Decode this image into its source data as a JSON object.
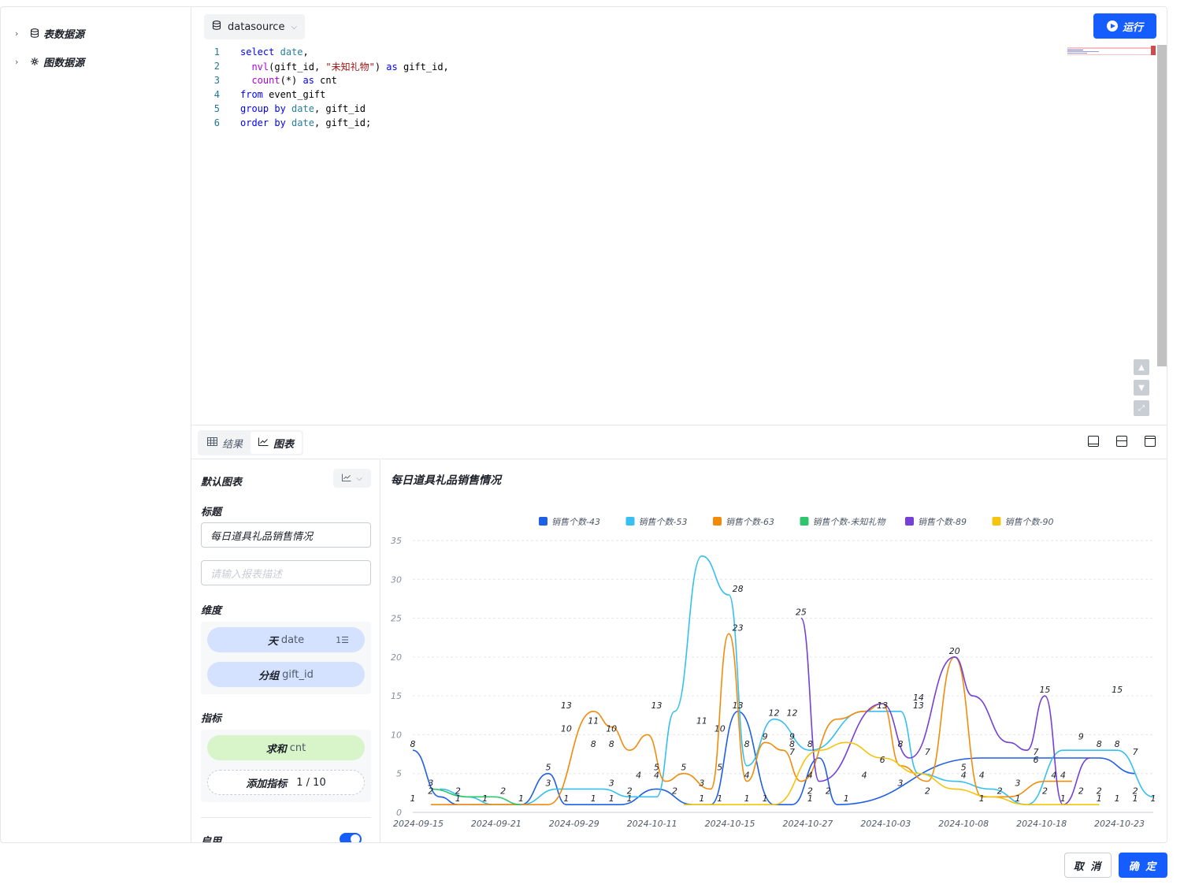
{
  "sidebar": {
    "items": [
      {
        "label": "表数据源",
        "icon": "database-icon"
      },
      {
        "label": "图数据源",
        "icon": "graph-icon"
      }
    ]
  },
  "toolbar": {
    "datasource_label": "datasource",
    "run_label": "运行"
  },
  "editor": {
    "lines": [
      {
        "n": "1",
        "text": "select date,"
      },
      {
        "n": "2",
        "text": "  nvl(gift_id, \"未知礼物\") as gift_id,"
      },
      {
        "n": "3",
        "text": "  count(*) as cnt"
      },
      {
        "n": "4",
        "text": "from event_gift"
      },
      {
        "n": "5",
        "text": "group by date, gift_id"
      },
      {
        "n": "6",
        "text": "order by date, gift_id;"
      }
    ]
  },
  "tabs": [
    {
      "label": "结果",
      "icon": "table-icon"
    },
    {
      "label": "图表",
      "icon": "line-chart-icon"
    }
  ],
  "config": {
    "default_chart_label": "默认图表",
    "title_label": "标题",
    "title_value": "每日道具礼品销售情况",
    "desc_placeholder": "请输入报表描述",
    "dimension_label": "维度",
    "dimensions": [
      {
        "prefix": "天",
        "field": "date"
      },
      {
        "prefix": "分组",
        "field": "gift_id"
      }
    ],
    "metric_label": "指标",
    "metric": {
      "prefix": "求和",
      "field": "cnt"
    },
    "add_metric": {
      "label": "添加指标",
      "count": "1 / 10"
    },
    "enable_label": "启用"
  },
  "chart_data": {
    "type": "line",
    "title": "每日道具礼品销售情况",
    "ylim": [
      0,
      35
    ],
    "yticks": [
      "0",
      "5",
      "10",
      "15",
      "20",
      "25",
      "30",
      "35"
    ],
    "xticks": [
      "2024-09-15",
      "2024-09-21",
      "2024-09-29",
      "2024-10-11",
      "2024-10-15",
      "2024-10-27",
      "2024-10-03",
      "2024-10-08",
      "2024-10-18",
      "2024-10-23"
    ],
    "legend_position": "top",
    "grid": true,
    "series": [
      {
        "name": "销售个数-43",
        "color": "#1f5fe6",
        "points": [
          [
            0,
            8
          ],
          [
            3,
            2
          ],
          [
            5,
            1
          ],
          [
            9,
            1
          ],
          [
            12,
            1
          ],
          [
            15,
            5
          ],
          [
            17,
            1
          ],
          [
            19,
            1
          ],
          [
            21,
            1
          ],
          [
            23,
            1
          ],
          [
            27,
            3
          ],
          [
            31,
            1
          ],
          [
            33,
            1
          ],
          [
            36,
            13
          ],
          [
            40,
            1
          ],
          [
            42,
            1
          ],
          [
            45,
            7
          ],
          [
            47,
            1
          ],
          [
            63,
            7
          ],
          [
            68,
            7
          ],
          [
            72,
            7
          ],
          [
            76,
            7
          ],
          [
            80,
            5
          ]
        ]
      },
      {
        "name": "销售个数-53",
        "color": "#36bff0",
        "points": [
          [
            3,
            3
          ],
          [
            6,
            2
          ],
          [
            9,
            1
          ],
          [
            12,
            1
          ],
          [
            16,
            3
          ],
          [
            18,
            3
          ],
          [
            21,
            3
          ],
          [
            24,
            2
          ],
          [
            27,
            2
          ],
          [
            29,
            13
          ],
          [
            32,
            33
          ],
          [
            35,
            28
          ],
          [
            37,
            6
          ],
          [
            40,
            12
          ],
          [
            44,
            8
          ],
          [
            50,
            13
          ],
          [
            54,
            13
          ],
          [
            56,
            5
          ],
          [
            60,
            4
          ],
          [
            64,
            3
          ],
          [
            68,
            1
          ],
          [
            72,
            8
          ],
          [
            78,
            8
          ],
          [
            82,
            2
          ]
        ]
      },
      {
        "name": "销售个数-63",
        "color": "#f28b0c",
        "points": [
          [
            2,
            1
          ],
          [
            15,
            1
          ],
          [
            20,
            13
          ],
          [
            22,
            11
          ],
          [
            24,
            8
          ],
          [
            26,
            10
          ],
          [
            28,
            4
          ],
          [
            30,
            5
          ],
          [
            33,
            3
          ],
          [
            35,
            23
          ],
          [
            37,
            4
          ],
          [
            39,
            9
          ],
          [
            41,
            8
          ],
          [
            43,
            4
          ],
          [
            47,
            12
          ],
          [
            50,
            13
          ],
          [
            52,
            14
          ],
          [
            54,
            6
          ],
          [
            57,
            4
          ],
          [
            60,
            20
          ],
          [
            63,
            2
          ],
          [
            66,
            2
          ],
          [
            70,
            4
          ],
          [
            73,
            4
          ]
        ]
      },
      {
        "name": "销售个数-未知礼物",
        "color": "#2fc56c",
        "points": [
          [
            2,
            3
          ],
          [
            6,
            2
          ],
          [
            9,
            2
          ],
          [
            12,
            1
          ]
        ]
      },
      {
        "name": "销售个数-89",
        "color": "#7440d6",
        "points": [
          [
            43,
            25
          ],
          [
            45,
            4
          ],
          [
            52,
            14
          ],
          [
            55,
            7
          ],
          [
            60,
            20
          ],
          [
            62,
            15
          ],
          [
            66,
            9
          ],
          [
            68,
            8
          ],
          [
            70,
            15
          ],
          [
            72,
            1
          ],
          [
            75,
            7
          ]
        ]
      },
      {
        "name": "销售个数-90",
        "color": "#f5c40f",
        "points": [
          [
            30,
            1
          ],
          [
            40,
            1
          ],
          [
            45,
            8
          ],
          [
            48,
            9
          ],
          [
            52,
            7
          ],
          [
            56,
            5
          ],
          [
            60,
            3
          ],
          [
            64,
            2
          ],
          [
            68,
            1
          ],
          [
            72,
            1
          ],
          [
            76,
            1
          ]
        ]
      }
    ],
    "data_labels": [
      {
        "v": "8",
        "x": 0,
        "y": 8
      },
      {
        "v": "1",
        "x": 0,
        "y": 1
      },
      {
        "v": "3",
        "x": 2,
        "y": 3
      },
      {
        "v": "2",
        "x": 2,
        "y": 2
      },
      {
        "v": "2",
        "x": 5,
        "y": 2
      },
      {
        "v": "1",
        "x": 5,
        "y": 1
      },
      {
        "v": "1",
        "x": 8,
        "y": 1
      },
      {
        "v": "2",
        "x": 10,
        "y": 2
      },
      {
        "v": "1",
        "x": 12,
        "y": 1
      },
      {
        "v": "5",
        "x": 15,
        "y": 5
      },
      {
        "v": "3",
        "x": 15,
        "y": 3
      },
      {
        "v": "1",
        "x": 17,
        "y": 1
      },
      {
        "v": "13",
        "x": 17,
        "y": 13
      },
      {
        "v": "10",
        "x": 17,
        "y": 10
      },
      {
        "v": "11",
        "x": 20,
        "y": 11
      },
      {
        "v": "8",
        "x": 20,
        "y": 8
      },
      {
        "v": "1",
        "x": 20,
        "y": 1
      },
      {
        "v": "10",
        "x": 22,
        "y": 10
      },
      {
        "v": "8",
        "x": 22,
        "y": 8
      },
      {
        "v": "3",
        "x": 22,
        "y": 3
      },
      {
        "v": "1",
        "x": 22,
        "y": 1
      },
      {
        "v": "2",
        "x": 24,
        "y": 2
      },
      {
        "v": "1",
        "x": 24,
        "y": 1
      },
      {
        "v": "4",
        "x": 25,
        "y": 4
      },
      {
        "v": "5",
        "x": 27,
        "y": 5
      },
      {
        "v": "4",
        "x": 27,
        "y": 4
      },
      {
        "v": "13",
        "x": 27,
        "y": 13
      },
      {
        "v": "2",
        "x": 29,
        "y": 2
      },
      {
        "v": "5",
        "x": 30,
        "y": 5
      },
      {
        "v": "11",
        "x": 32,
        "y": 11
      },
      {
        "v": "3",
        "x": 32,
        "y": 3
      },
      {
        "v": "1",
        "x": 32,
        "y": 1
      },
      {
        "v": "10",
        "x": 34,
        "y": 10
      },
      {
        "v": "5",
        "x": 34,
        "y": 5
      },
      {
        "v": "1",
        "x": 34,
        "y": 1
      },
      {
        "v": "28",
        "x": 36,
        "y": 28
      },
      {
        "v": "23",
        "x": 36,
        "y": 23
      },
      {
        "v": "13",
        "x": 36,
        "y": 13
      },
      {
        "v": "8",
        "x": 37,
        "y": 8
      },
      {
        "v": "4",
        "x": 37,
        "y": 4
      },
      {
        "v": "1",
        "x": 37,
        "y": 1
      },
      {
        "v": "9",
        "x": 39,
        "y": 9
      },
      {
        "v": "1",
        "x": 39,
        "y": 1
      },
      {
        "v": "12",
        "x": 40,
        "y": 12
      },
      {
        "v": "12",
        "x": 42,
        "y": 12
      },
      {
        "v": "25",
        "x": 43,
        "y": 25
      },
      {
        "v": "9",
        "x": 42,
        "y": 9
      },
      {
        "v": "8",
        "x": 42,
        "y": 8
      },
      {
        "v": "7",
        "x": 42,
        "y": 7
      },
      {
        "v": "8",
        "x": 44,
        "y": 8
      },
      {
        "v": "4",
        "x": 44,
        "y": 4
      },
      {
        "v": "2",
        "x": 44,
        "y": 2
      },
      {
        "v": "1",
        "x": 44,
        "y": 1
      },
      {
        "v": "2",
        "x": 46,
        "y": 2
      },
      {
        "v": "1",
        "x": 48,
        "y": 1
      },
      {
        "v": "4",
        "x": 50,
        "y": 4
      },
      {
        "v": "6",
        "x": 52,
        "y": 6
      },
      {
        "v": "13",
        "x": 52,
        "y": 13
      },
      {
        "v": "8",
        "x": 54,
        "y": 8
      },
      {
        "v": "3",
        "x": 54,
        "y": 3
      },
      {
        "v": "14",
        "x": 56,
        "y": 14
      },
      {
        "v": "13",
        "x": 56,
        "y": 13
      },
      {
        "v": "7",
        "x": 57,
        "y": 7
      },
      {
        "v": "2",
        "x": 57,
        "y": 2
      },
      {
        "v": "20",
        "x": 60,
        "y": 20
      },
      {
        "v": "5",
        "x": 61,
        "y": 5
      },
      {
        "v": "4",
        "x": 61,
        "y": 4
      },
      {
        "v": "4",
        "x": 63,
        "y": 4
      },
      {
        "v": "1",
        "x": 63,
        "y": 1
      },
      {
        "v": "2",
        "x": 65,
        "y": 2
      },
      {
        "v": "1",
        "x": 67,
        "y": 1
      },
      {
        "v": "3",
        "x": 67,
        "y": 3
      },
      {
        "v": "7",
        "x": 69,
        "y": 7
      },
      {
        "v": "6",
        "x": 69,
        "y": 6
      },
      {
        "v": "2",
        "x": 70,
        "y": 2
      },
      {
        "v": "15",
        "x": 70,
        "y": 15
      },
      {
        "v": "4",
        "x": 71,
        "y": 4
      },
      {
        "v": "4",
        "x": 72,
        "y": 4
      },
      {
        "v": "1",
        "x": 72,
        "y": 1
      },
      {
        "v": "9",
        "x": 74,
        "y": 9
      },
      {
        "v": "2",
        "x": 74,
        "y": 2
      },
      {
        "v": "8",
        "x": 76,
        "y": 8
      },
      {
        "v": "2",
        "x": 76,
        "y": 2
      },
      {
        "v": "1",
        "x": 76,
        "y": 1
      },
      {
        "v": "8",
        "x": 78,
        "y": 8
      },
      {
        "v": "15",
        "x": 78,
        "y": 15
      },
      {
        "v": "1",
        "x": 78,
        "y": 1
      },
      {
        "v": "7",
        "x": 80,
        "y": 7
      },
      {
        "v": "2",
        "x": 80,
        "y": 2
      },
      {
        "v": "1",
        "x": 80,
        "y": 1
      },
      {
        "v": "1",
        "x": 82,
        "y": 1
      }
    ],
    "x_max": 82
  },
  "footer": {
    "cancel_label": "取 消",
    "ok_label": "确 定"
  }
}
